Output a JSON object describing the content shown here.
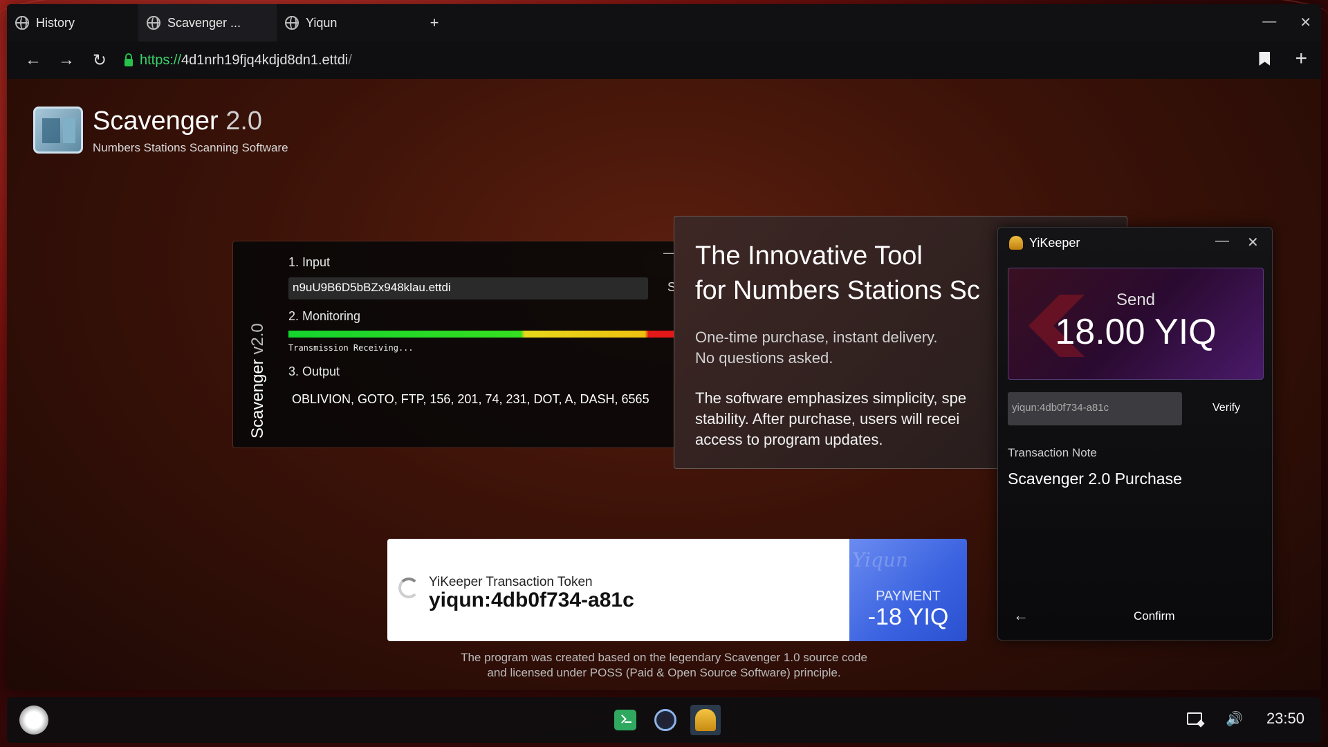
{
  "browser": {
    "tabs": [
      {
        "label": "History",
        "icon": "globe-icon"
      },
      {
        "label": "Scavenger ...",
        "icon": "globe-icon"
      },
      {
        "label": "Yiqun",
        "icon": "globe-icon"
      }
    ],
    "new_tab": "+",
    "url": {
      "scheme": "https://",
      "host": "4d1nrh19fjq4kdjd8dn1.ettdi",
      "path": "/"
    }
  },
  "page": {
    "app_name": "Scavenger",
    "app_version": "2.0",
    "app_subtitle": "Numbers Stations Scanning Software",
    "scavenger_panel": {
      "vertical_title": "Scavenger",
      "vertical_version": "v2.0",
      "step_input": "1. Input",
      "input_value": "n9uU9B6D5bBZx948klau.ettdi",
      "start_label": "St",
      "step_monitoring": "2. Monitoring",
      "status": "Transmission Receiving...",
      "step_output": "3. Output",
      "output": "OBLIVION, GOTO, FTP, 156, 201, 74, 231, DOT, A, DASH, 6565"
    },
    "promo": {
      "title_line1": "The Innovative Tool",
      "title_line2": "for Numbers Stations Sc",
      "p1_line1": "One-time purchase, instant delivery.",
      "p1_line2": "No questions asked.",
      "p2_line1": "The software emphasizes simplicity, spe",
      "p2_line2": "stability. After purchase, users will recei",
      "p2_line3": "access to program updates."
    },
    "token": {
      "label": "YiKeeper Transaction Token",
      "value": "yiqun:4db0f734-a81c",
      "payment_watermark": "Yiqun",
      "payment_label": "PAYMENT",
      "payment_amount": "-18 YIQ"
    },
    "footer_line1": "The program was created based on the legendary Scavenger 1.0 source code",
    "footer_line2": "and licensed under POSS (Paid & Open Source Software) principle."
  },
  "yikeeper": {
    "title": "YiKeeper",
    "send_label": "Send",
    "send_amount": "18.00 YIQ",
    "token_value": "yiqun:4db0f734-a81c",
    "verify": "Verify",
    "note_label": "Transaction Note",
    "note_value": "Scavenger 2.0 Purchase",
    "confirm": "Confirm"
  },
  "taskbar": {
    "clock": "23:50"
  },
  "colors": {
    "accent_green": "#3cd26a",
    "payment_blue": "#3a62e0"
  }
}
